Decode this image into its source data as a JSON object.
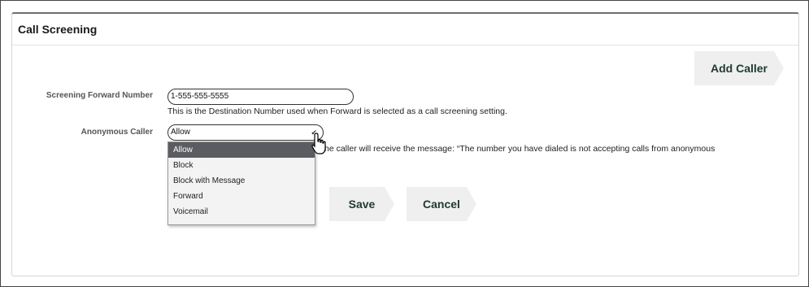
{
  "panel": {
    "title": "Call Screening"
  },
  "actions": {
    "add_caller_label": "Add Caller",
    "save_label": "Save",
    "cancel_label": "Cancel"
  },
  "screening_forward": {
    "label": "Screening Forward Number",
    "value": "1-555-555-5555",
    "helper": "This is the Destination Number used when Forward is selected as a call screening setting."
  },
  "anonymous_caller": {
    "label": "Anonymous Caller",
    "selected": "Allow",
    "helper": "he caller will receive the message: “The number you have dialed is not accepting calls from anonymous",
    "options": [
      "Allow",
      "Block",
      "Block with Message",
      "Forward",
      "Voicemail"
    ]
  },
  "icons": {
    "dropdown": "chevron-down-icon",
    "cursor": "pointer-cursor-icon"
  }
}
